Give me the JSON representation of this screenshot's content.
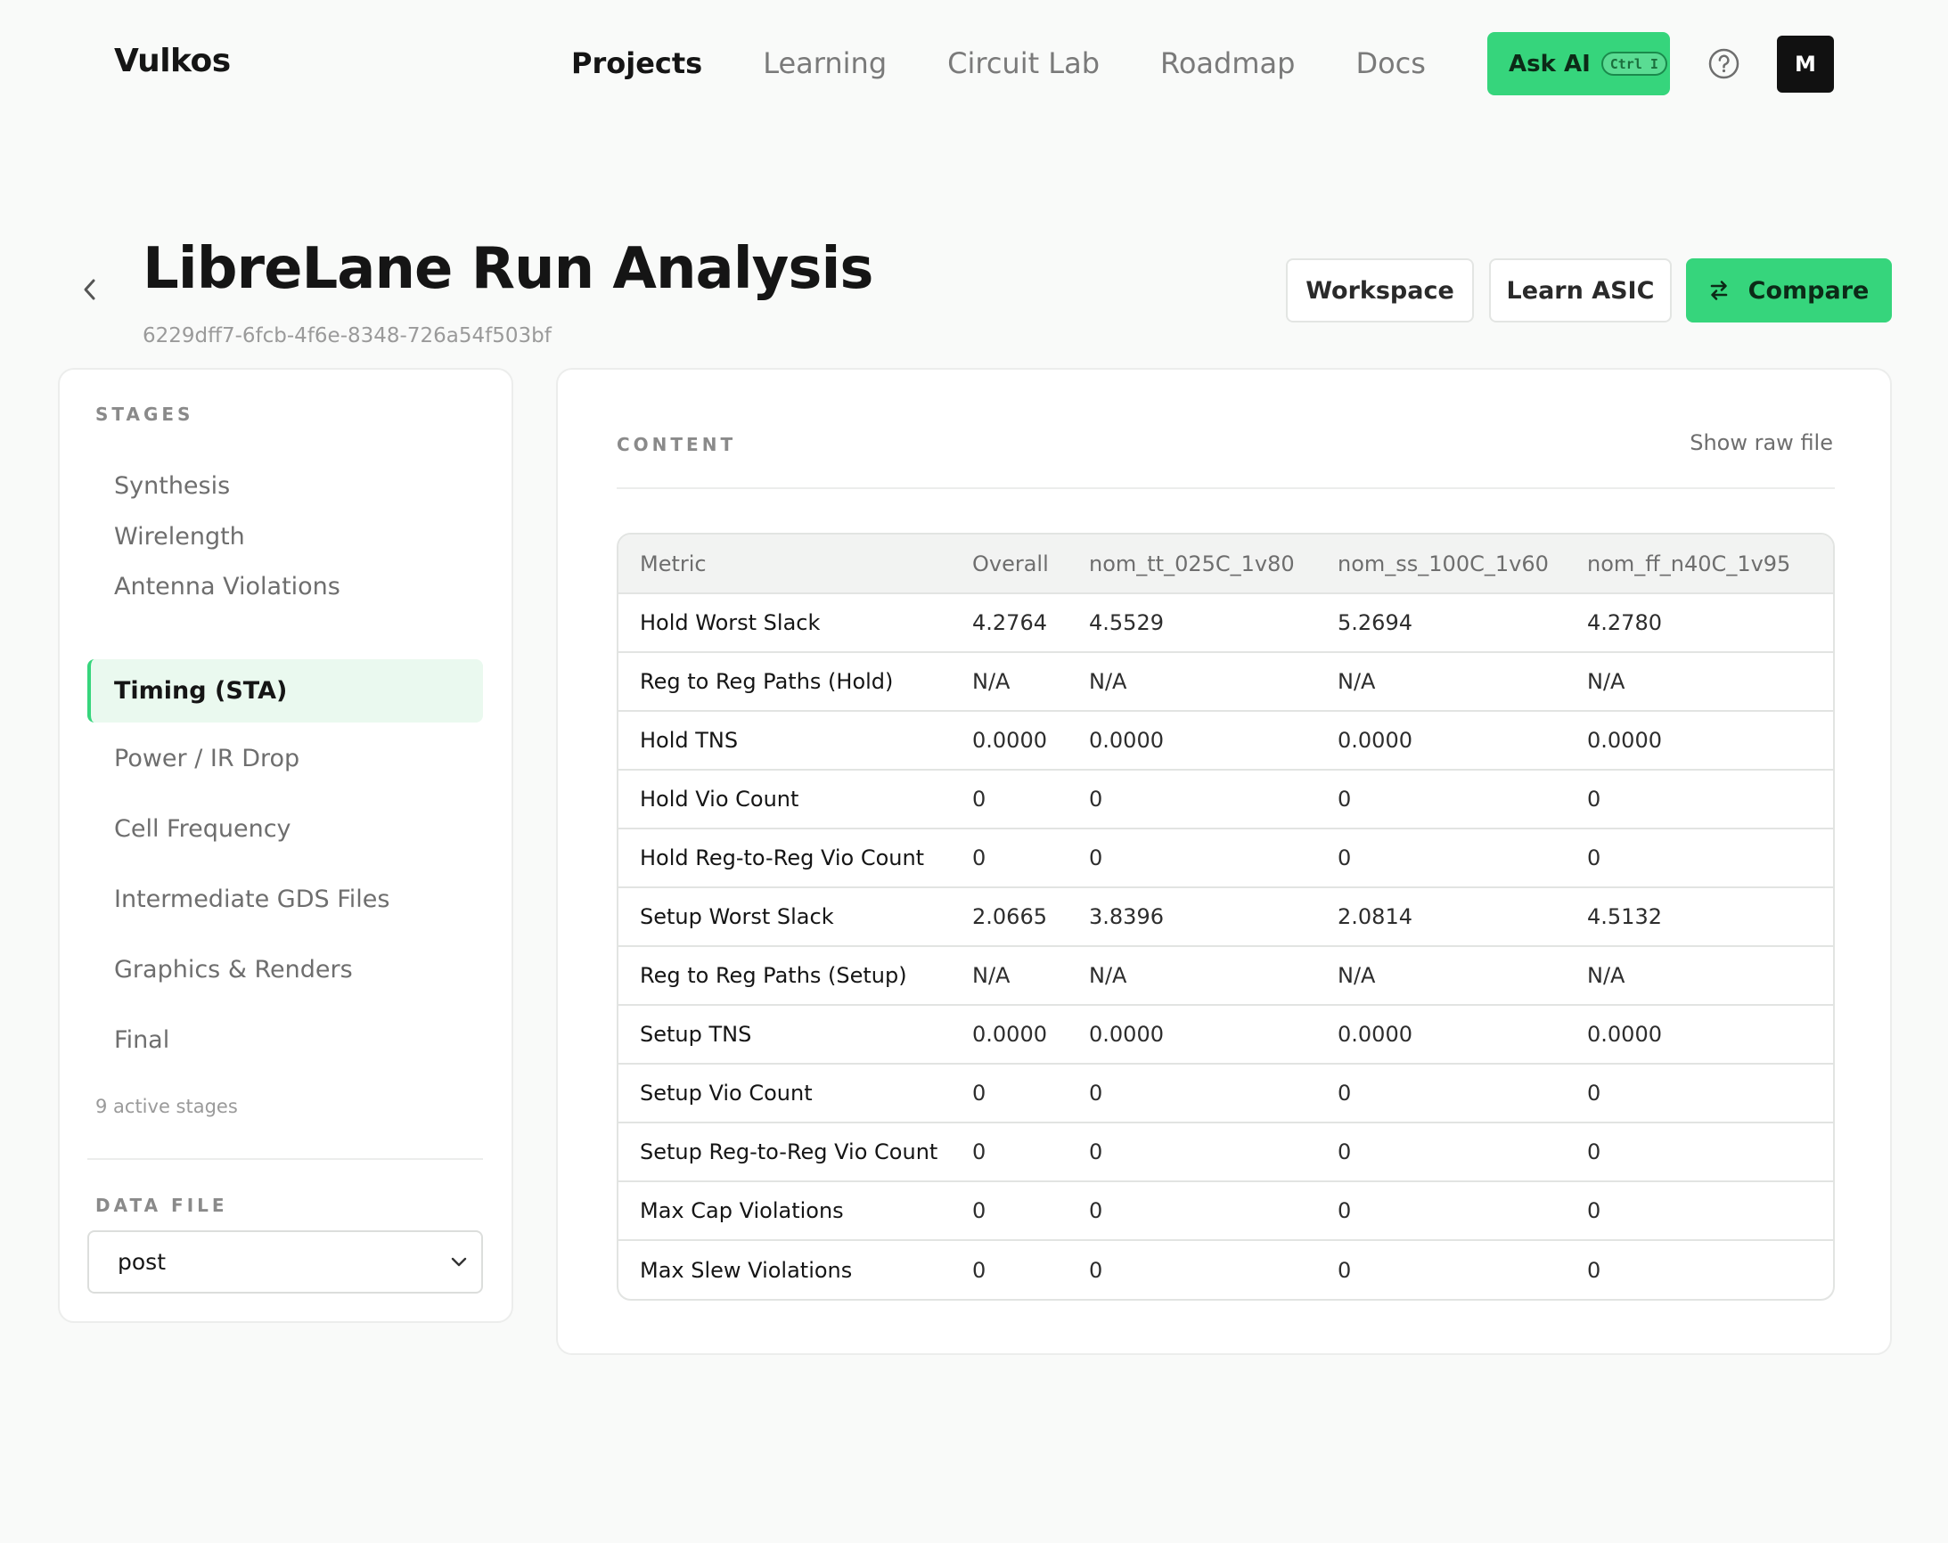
{
  "nav": {
    "brand": "Vulkos",
    "links": [
      "Projects",
      "Learning",
      "Circuit Lab",
      "Roadmap",
      "Docs"
    ],
    "ask_ai": "Ask AI",
    "shortcut": "Ctrl I",
    "avatar_initial": "M"
  },
  "header": {
    "title": "LibreLane Run Analysis",
    "run_id": "6229dff7-6fcb-4f6e-8348-726a54f503bf",
    "buttons": {
      "workspace": "Workspace",
      "learn": "Learn ASIC",
      "compare": "Compare"
    }
  },
  "sidebar": {
    "stages_label": "STAGES",
    "stages": [
      "Synthesis",
      "Wirelength",
      "Antenna Violations",
      "Timing (STA)",
      "Power / IR Drop",
      "Cell Frequency",
      "Intermediate GDS Files",
      "Graphics & Renders",
      "Final"
    ],
    "active_stage": "Timing (STA)",
    "stage_count": "9 active stages",
    "data_file_label": "DATA FILE",
    "data_file_value": "post"
  },
  "content": {
    "label": "CONTENT",
    "raw_link": "Show raw file",
    "columns": [
      "Metric",
      "Overall",
      "nom_tt_025C_1v80",
      "nom_ss_100C_1v60",
      "nom_ff_n40C_1v95"
    ],
    "rows": [
      [
        "Hold Worst Slack",
        "4.2764",
        "4.5529",
        "5.2694",
        "4.2780"
      ],
      [
        "Reg to Reg Paths (Hold)",
        "N/A",
        "N/A",
        "N/A",
        "N/A"
      ],
      [
        "Hold TNS",
        "0.0000",
        "0.0000",
        "0.0000",
        "0.0000"
      ],
      [
        "Hold Vio Count",
        "0",
        "0",
        "0",
        "0"
      ],
      [
        "Hold Reg-to-Reg Vio Count",
        "0",
        "0",
        "0",
        "0"
      ],
      [
        "Setup Worst Slack",
        "2.0665",
        "3.8396",
        "2.0814",
        "4.5132"
      ],
      [
        "Reg to Reg Paths (Setup)",
        "N/A",
        "N/A",
        "N/A",
        "N/A"
      ],
      [
        "Setup TNS",
        "0.0000",
        "0.0000",
        "0.0000",
        "0.0000"
      ],
      [
        "Setup Vio Count",
        "0",
        "0",
        "0",
        "0"
      ],
      [
        "Setup Reg-to-Reg Vio Count",
        "0",
        "0",
        "0",
        "0"
      ],
      [
        "Max Cap Violations",
        "0",
        "0",
        "0",
        "0"
      ],
      [
        "Max Slew Violations",
        "0",
        "0",
        "0",
        "0"
      ]
    ]
  },
  "colors": {
    "accent": "#36d57c",
    "active_bg": "#eaf9ef",
    "background": "#f9faf9"
  },
  "icons": [
    "back-chevron-icon",
    "help-circle-icon",
    "swap-arrows-icon",
    "chevron-down-icon"
  ]
}
